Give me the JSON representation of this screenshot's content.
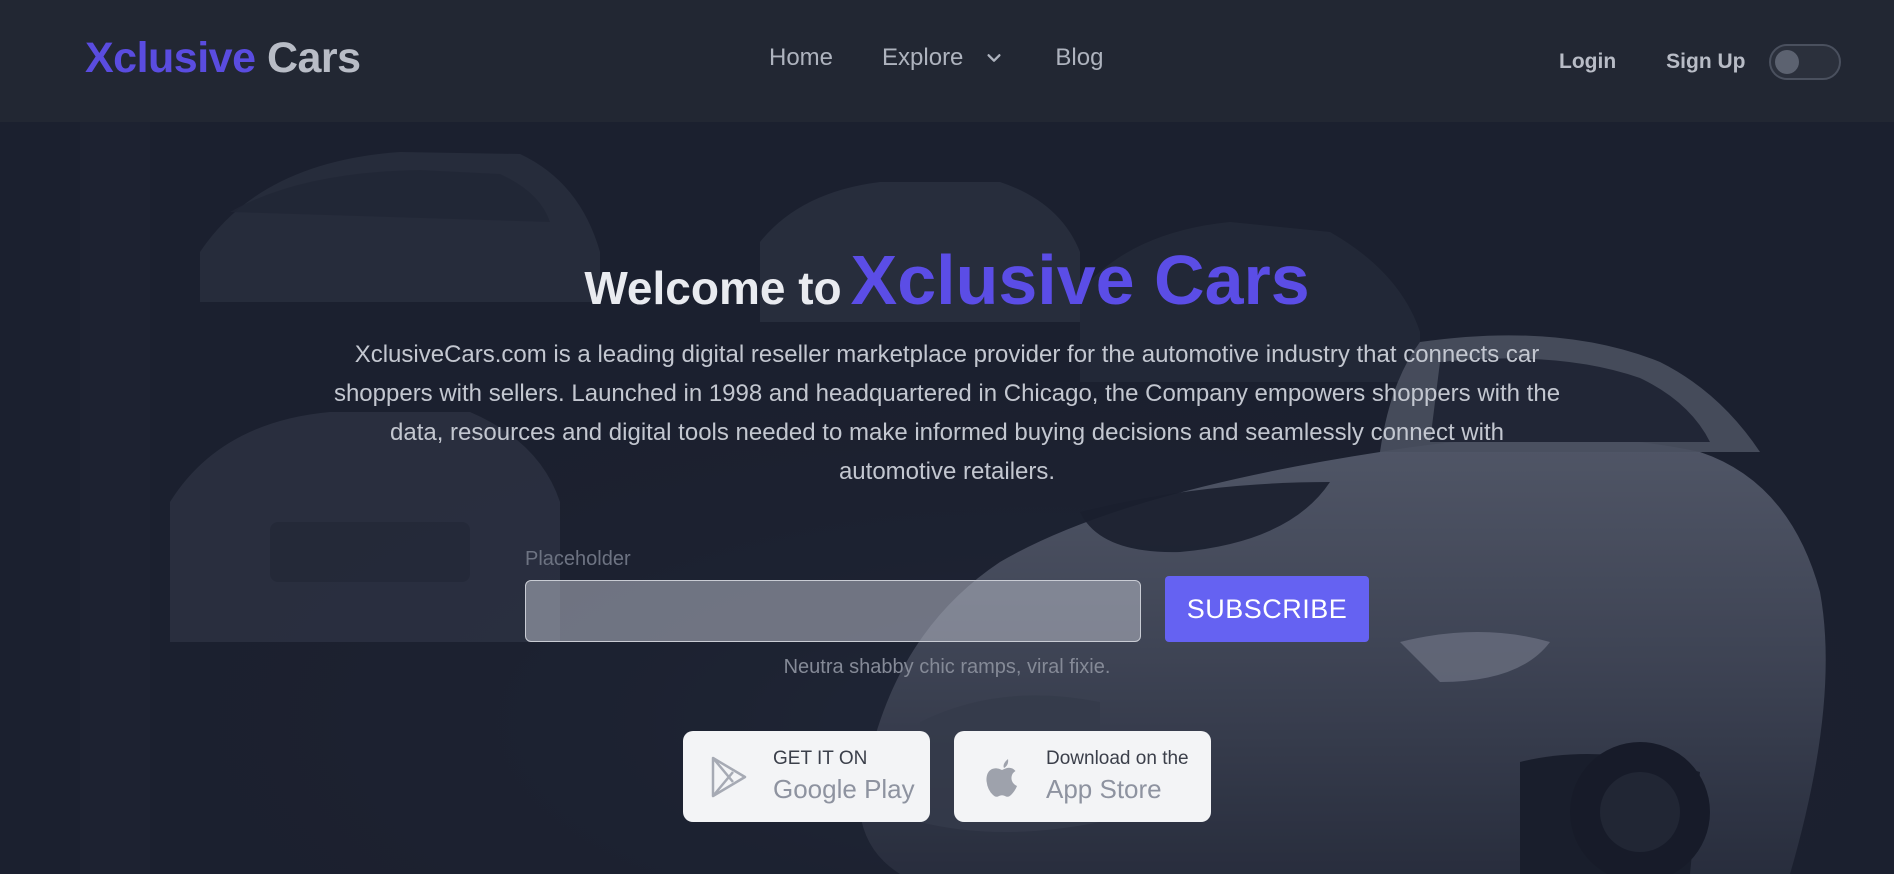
{
  "logo": {
    "accent": "Xclusive",
    "rest": "Cars"
  },
  "nav": {
    "home": "Home",
    "explore": "Explore",
    "blog": "Blog",
    "login": "Login",
    "signup": "Sign Up",
    "theme_toggle_on": false
  },
  "hero": {
    "welcome": "Welcome to",
    "brand": "Xclusive Cars",
    "description": "XclusiveCars.com is a leading digital reseller marketplace provider for the automotive industry that connects car shoppers with sellers. Launched in 1998 and headquartered in Chicago, the Company empowers shoppers with the data, resources and digital tools needed to make informed buying decisions and seamlessly connect with automotive retailers.",
    "email_label": "Placeholder",
    "email_value": "",
    "subscribe": "SUBSCRIBE",
    "fine_print": "Neutra shabby chic ramps, viral fixie."
  },
  "stores": {
    "google": {
      "small": "GET IT ON",
      "big": "Google Play",
      "icon": "google-play-icon"
    },
    "apple": {
      "small": "Download on the",
      "big": "App Store",
      "icon": "apple-icon"
    }
  },
  "colors": {
    "brand_accent": "#5b4de6",
    "subscribe_button": "#6562f2",
    "navbar_bg": "#222733"
  }
}
